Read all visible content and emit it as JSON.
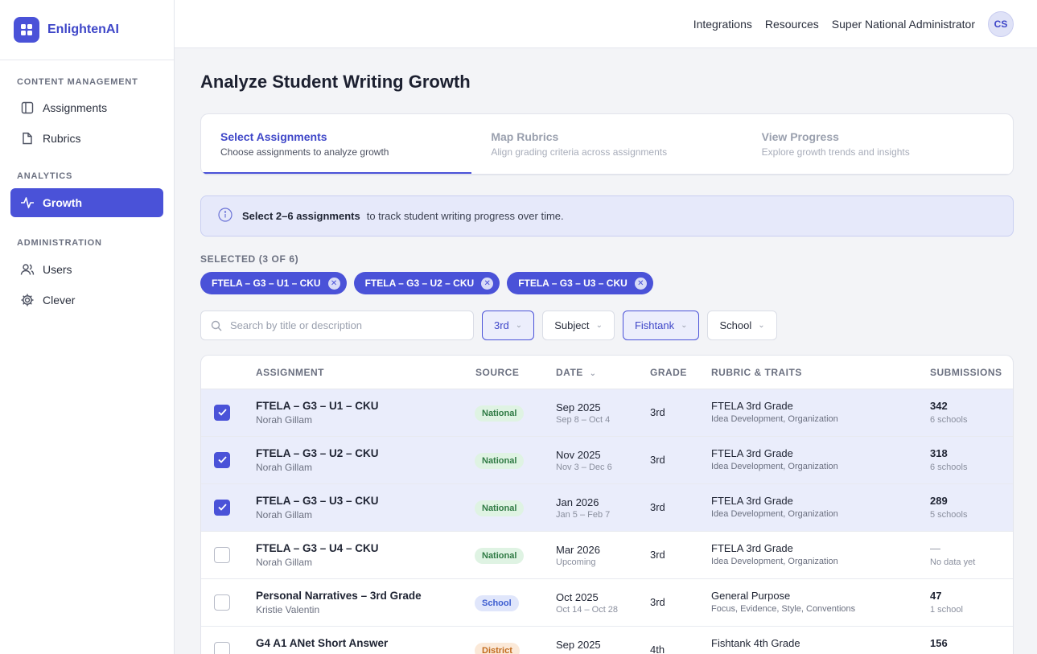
{
  "app": {
    "name": "EnlightenAI"
  },
  "sidebar": {
    "sections": [
      {
        "label": "CONTENT MANAGEMENT",
        "items": [
          {
            "label": "Assignments",
            "icon": "layout-icon"
          },
          {
            "label": "Rubrics",
            "icon": "document-icon"
          }
        ]
      },
      {
        "label": "ANALYTICS",
        "items": [
          {
            "label": "Growth",
            "icon": "pulse-icon",
            "active": true
          }
        ]
      },
      {
        "label": "ADMINISTRATION",
        "items": [
          {
            "label": "Users",
            "icon": "users-icon"
          },
          {
            "label": "Clever",
            "icon": "gear-icon"
          }
        ]
      }
    ]
  },
  "topbar": {
    "links": [
      "Integrations",
      "Resources",
      "Super National Administrator"
    ],
    "avatar_initials": "CS"
  },
  "page": {
    "title": "Analyze Student Writing Growth"
  },
  "stepper": [
    {
      "title": "Select Assignments",
      "subtitle": "Choose assignments to analyze growth",
      "active": true
    },
    {
      "title": "Map Rubrics",
      "subtitle": "Align grading criteria across assignments",
      "active": false
    },
    {
      "title": "View Progress",
      "subtitle": "Explore growth trends and insights",
      "active": false
    }
  ],
  "banner": {
    "strong": "Select 2–6 assignments",
    "rest": "to track student writing progress over time."
  },
  "selection": {
    "label": "SELECTED (3 OF 6)",
    "chips": [
      "FTELA – G3 – U1 – CKU",
      "FTELA – G3 – U2 – CKU",
      "FTELA – G3 – U3 – CKU"
    ]
  },
  "filters": {
    "search_placeholder": "Search by title or description",
    "items": [
      {
        "label": "3rd",
        "active": true
      },
      {
        "label": "Subject",
        "active": false
      },
      {
        "label": "Fishtank",
        "active": true
      },
      {
        "label": "School",
        "active": false
      }
    ]
  },
  "table": {
    "columns": [
      "ASSIGNMENT",
      "SOURCE",
      "DATE",
      "GRADE",
      "RUBRIC & TRAITS",
      "SUBMISSIONS"
    ],
    "rows": [
      {
        "selected": true,
        "title": "FTELA – G3 – U1 – CKU",
        "author": "Norah Gillam",
        "source": "National",
        "source_type": "national",
        "date": "Sep 2025",
        "range": "Sep 8 – Oct 4",
        "grade": "3rd",
        "rubric": "FTELA 3rd Grade",
        "traits": "Idea Development, Organization",
        "submissions": "342",
        "schools": "6 schools"
      },
      {
        "selected": true,
        "title": "FTELA – G3 – U2 – CKU",
        "author": "Norah Gillam",
        "source": "National",
        "source_type": "national",
        "date": "Nov 2025",
        "range": "Nov 3 – Dec 6",
        "grade": "3rd",
        "rubric": "FTELA 3rd Grade",
        "traits": "Idea Development, Organization",
        "submissions": "318",
        "schools": "6 schools"
      },
      {
        "selected": true,
        "title": "FTELA – G3 – U3 – CKU",
        "author": "Norah Gillam",
        "source": "National",
        "source_type": "national",
        "date": "Jan 2026",
        "range": "Jan 5 – Feb 7",
        "grade": "3rd",
        "rubric": "FTELA 3rd Grade",
        "traits": "Idea Development, Organization",
        "submissions": "289",
        "schools": "5 schools"
      },
      {
        "selected": false,
        "title": "FTELA – G3 – U4 – CKU",
        "author": "Norah Gillam",
        "source": "National",
        "source_type": "national",
        "date": "Mar 2026",
        "range": "Upcoming",
        "grade": "3rd",
        "rubric": "FTELA 3rd Grade",
        "traits": "Idea Development, Organization",
        "submissions": "—",
        "schools": "No data yet"
      },
      {
        "selected": false,
        "title": "Personal Narratives – 3rd Grade",
        "author": "Kristie Valentin",
        "source": "School",
        "source_type": "school",
        "date": "Oct 2025",
        "range": "Oct 14 – Oct 28",
        "grade": "3rd",
        "rubric": "General Purpose",
        "traits": "Focus, Evidence, Style, Conventions",
        "submissions": "47",
        "schools": "1 school"
      },
      {
        "selected": false,
        "title": "G4 A1 ANet Short Answer",
        "author": "",
        "source": "District",
        "source_type": "district",
        "date": "Sep 2025",
        "range": "",
        "grade": "4th",
        "rubric": "Fishtank 4th Grade",
        "traits": "",
        "submissions": "156",
        "schools": ""
      }
    ]
  },
  "colors": {
    "accent": "#4a52d8",
    "national": "#2f7a44",
    "school": "#3e5ed0",
    "district": "#c26b1e"
  }
}
